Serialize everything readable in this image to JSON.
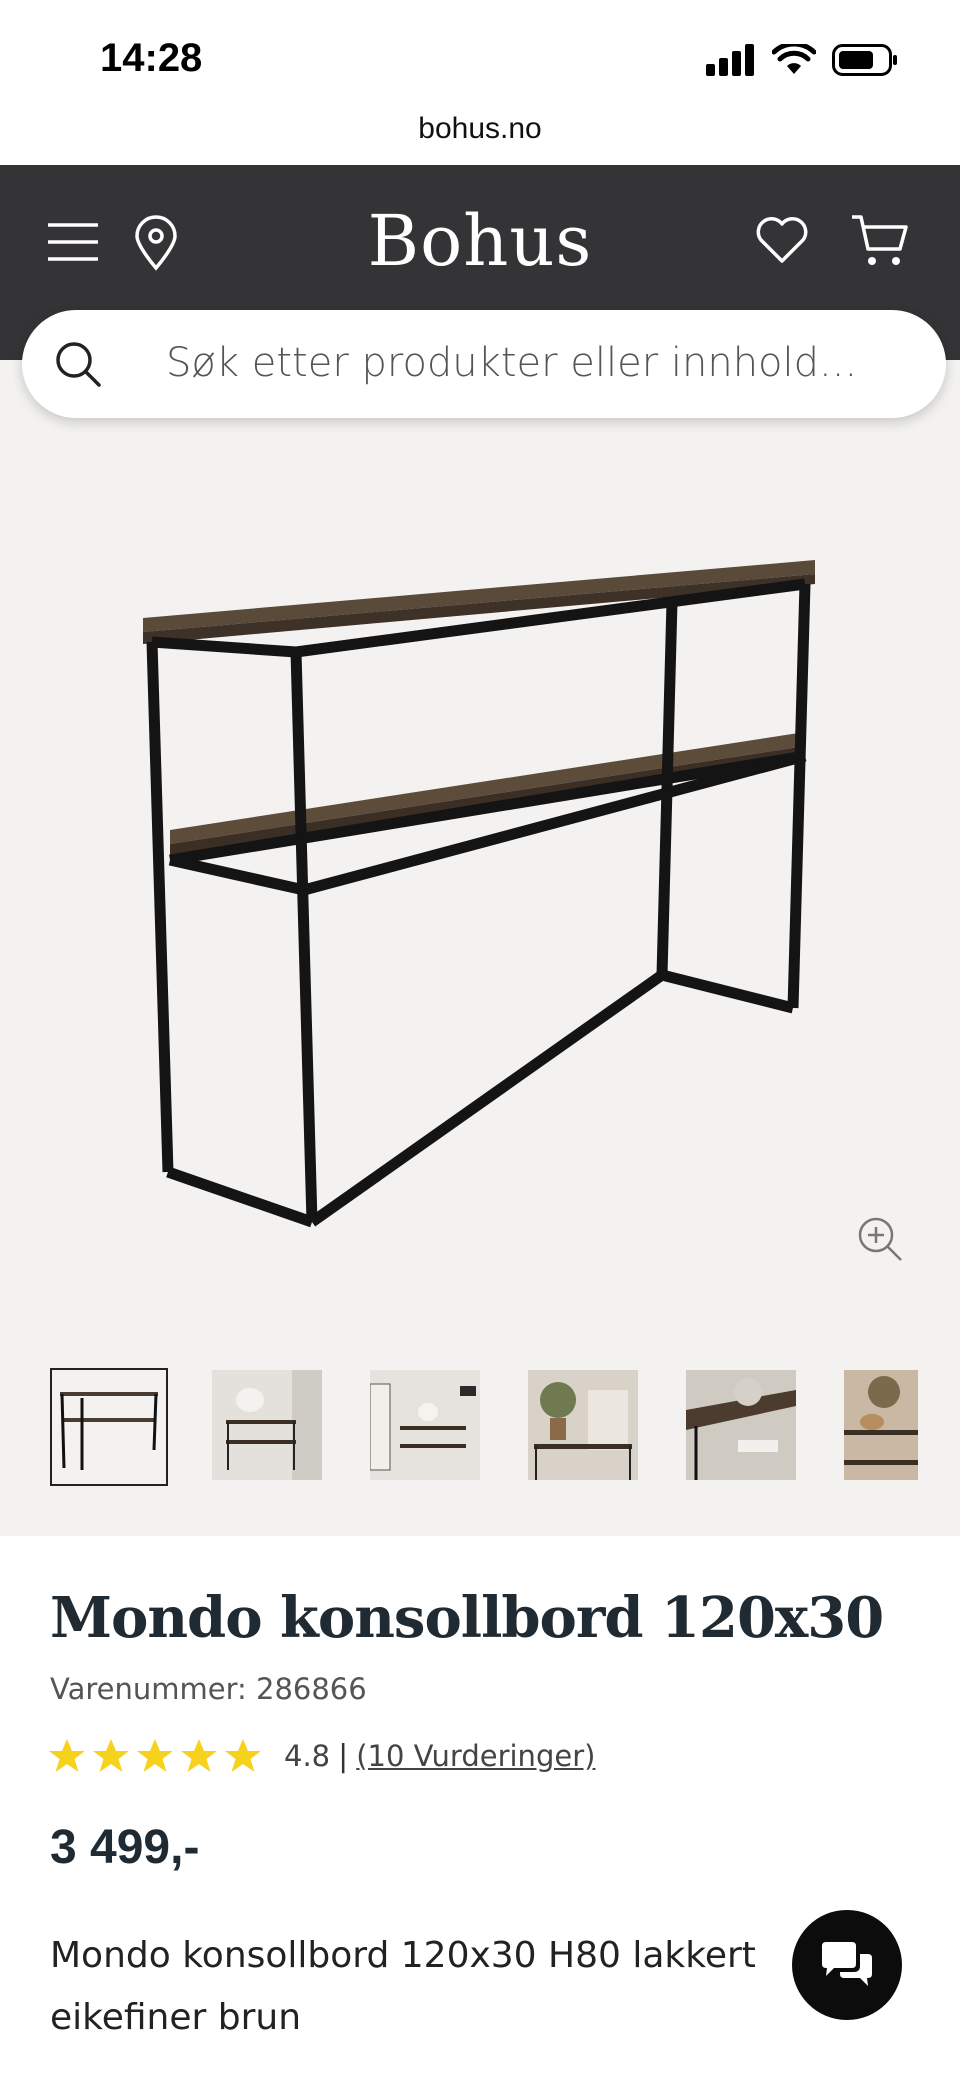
{
  "status_bar": {
    "time": "14:28"
  },
  "browser": {
    "url": "bohus.no"
  },
  "header": {
    "logo": "Bohus"
  },
  "search": {
    "placeholder": "Søk etter produkter eller innhold..."
  },
  "gallery": {
    "thumbnails": [
      "console table",
      "console with lamp",
      "console with mirror",
      "console with plant",
      "console closeup",
      "console with decor"
    ]
  },
  "product": {
    "title": "Mondo konsollbord 120x30",
    "sku_label": "Varenummer: 286866",
    "rating_value": "4.8",
    "rating_separator": "|",
    "reviews_label": "(10 Vurderinger)",
    "stars": 5,
    "price": "3 499,-",
    "description": "Mondo konsollbord 120x30 H80 lakkert eikefiner brun"
  },
  "colors": {
    "header_bg": "#343437",
    "star": "#f7d21c",
    "gallery_bg": "#f3f2f0"
  }
}
